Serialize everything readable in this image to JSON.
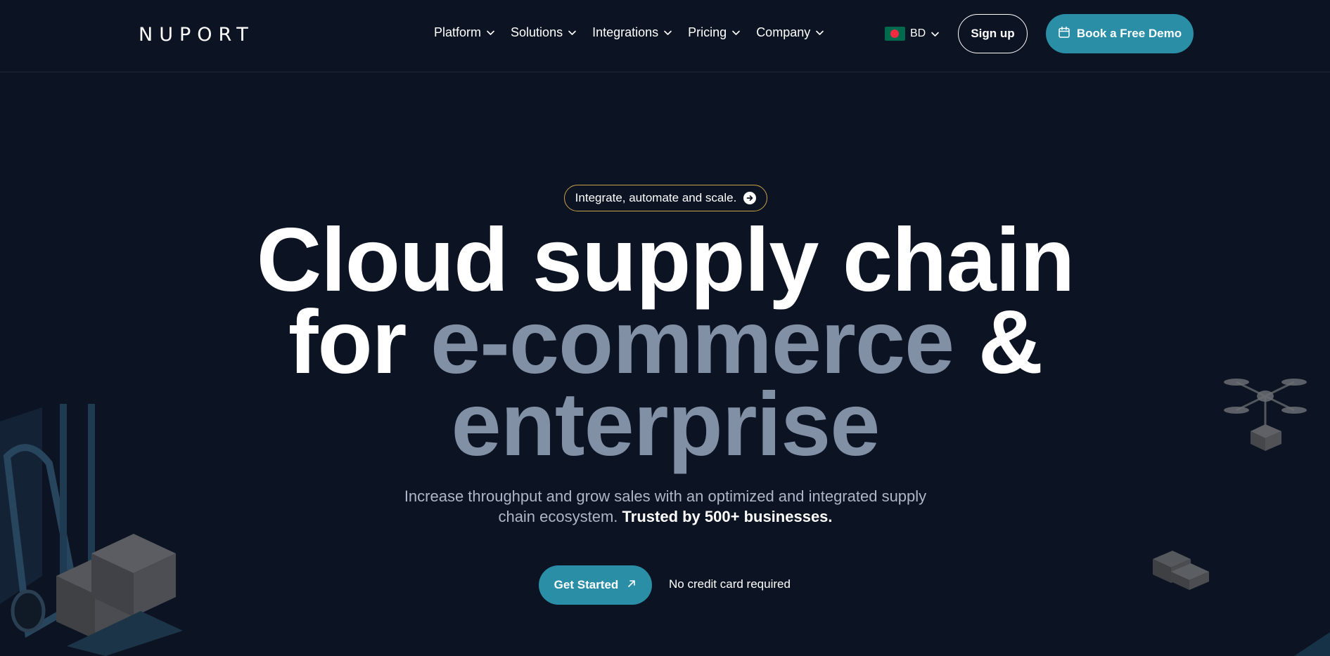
{
  "header": {
    "logo": "NUPORT",
    "nav": [
      {
        "label": "Platform"
      },
      {
        "label": "Solutions"
      },
      {
        "label": "Integrations"
      },
      {
        "label": "Pricing"
      },
      {
        "label": "Company"
      }
    ],
    "locale": {
      "code": "BD",
      "flag_icon": "bangladesh-flag-icon"
    },
    "signup_label": "Sign up",
    "demo_label": "Book a Free Demo",
    "demo_icon": "calendar-icon"
  },
  "hero": {
    "pill_text": "Integrate, automate and scale.",
    "headline_line1": "Cloud supply chain",
    "headline_for": "for ",
    "headline_ecommerce": "e-commerce",
    "headline_amp": " &",
    "headline_line3": "enterprise",
    "subtext_main": "Increase throughput and grow sales with an optimized and integrated supply chain ecosystem.",
    "subtext_bold": "Trusted by 500+ businesses.",
    "cta_label": "Get Started",
    "cta_note": "No credit card required"
  },
  "colors": {
    "background": "#0c1322",
    "accent": "#2a8ea6",
    "pill_border": "#c8a24a",
    "headline_gray": "#8290a6"
  }
}
